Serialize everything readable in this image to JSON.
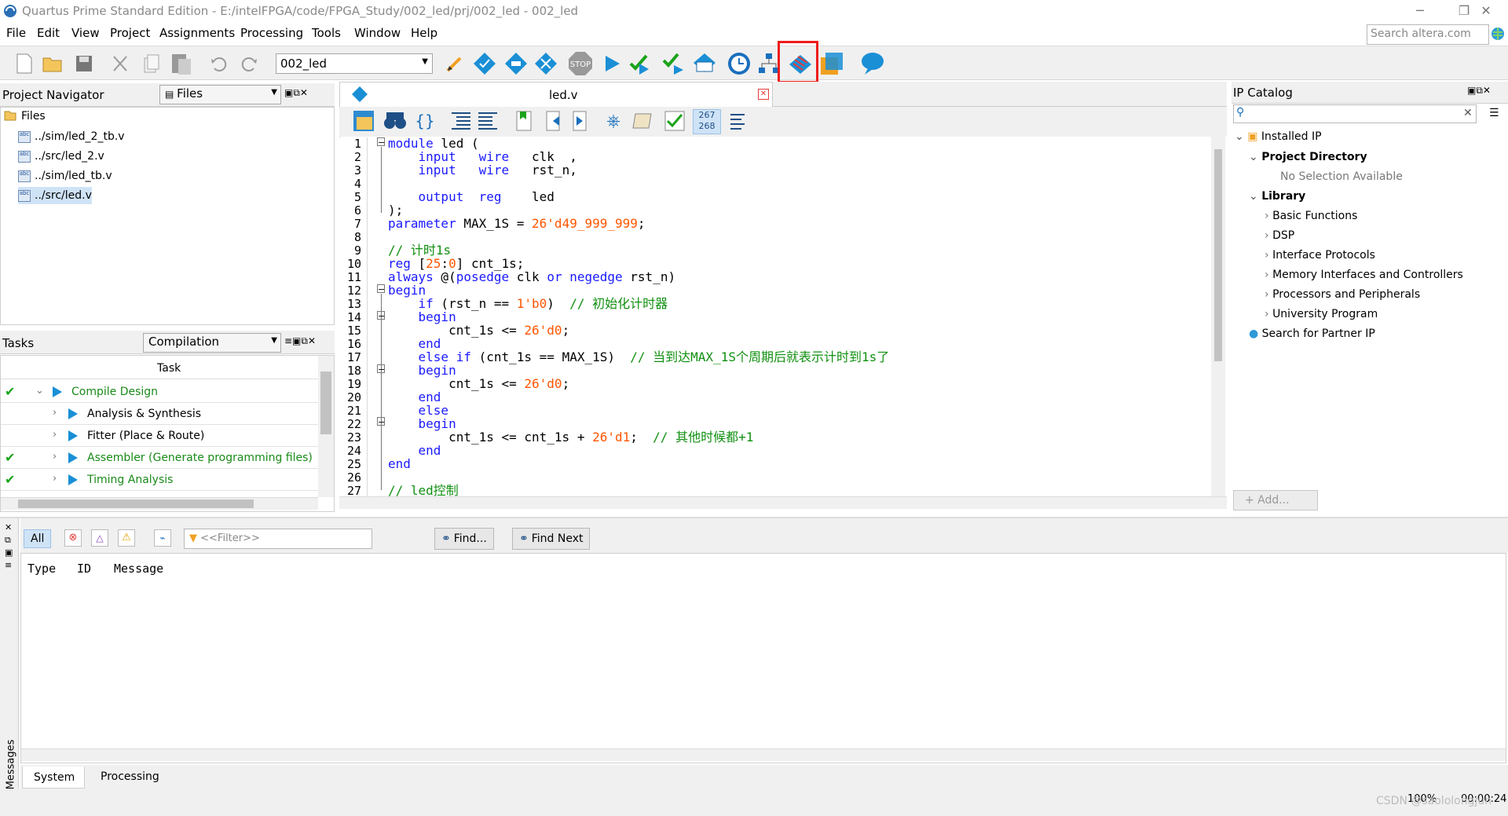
{
  "window": {
    "title": "Quartus Prime Standard Edition - E:/intelFPGA/code/FPGA_Study/002_led/prj/002_led - 002_led",
    "controls": [
      "─",
      "❐",
      "✕"
    ]
  },
  "menu": [
    "File",
    "Edit",
    "View",
    "Project",
    "Assignments",
    "Processing",
    "Tools",
    "Window",
    "Help"
  ],
  "search": {
    "placeholder": "Search altera.com"
  },
  "toolbar": {
    "project_value": "002_led",
    "stop_label": "STOP",
    "icons": [
      "new-file",
      "open-file",
      "save",
      "cut",
      "copy",
      "paste",
      "undo",
      "redo",
      "pin-planner",
      "compile-design",
      "analysis-synthesis",
      "fitter",
      "stop",
      "start-compilation",
      "analysis-elaboration",
      "assembler",
      "timing-analyzer",
      "chip-planner",
      "netlist-viewer",
      "programmer",
      "ip-catalog-tool",
      "help-balloon"
    ]
  },
  "project_navigator": {
    "title": "Project Navigator",
    "view": "Files",
    "root": "Files",
    "files": [
      "../sim/led_2_tb.v",
      "../src/led_2.v",
      "../sim/led_tb.v",
      "../src/led.v"
    ]
  },
  "tasks": {
    "title": "Tasks",
    "flow": "Compilation",
    "header": "Task",
    "rows": [
      {
        "label": "Compile Design",
        "done": true
      },
      {
        "label": "Analysis & Synthesis",
        "done": false
      },
      {
        "label": "Fitter (Place & Route)",
        "done": false
      },
      {
        "label": "Assembler (Generate programming files)",
        "done": true
      },
      {
        "label": "Timing Analysis",
        "done": true
      }
    ]
  },
  "editor": {
    "tab": "led.v",
    "line_counter": [
      "267",
      "268"
    ],
    "line_numbers": [
      "1",
      "2",
      "3",
      "4",
      "5",
      "6",
      "7",
      "8",
      "9",
      "10",
      "11",
      "12",
      "13",
      "14",
      "15",
      "16",
      "17",
      "18",
      "19",
      "20",
      "21",
      "22",
      "23",
      "24",
      "25",
      "26",
      "27"
    ]
  },
  "ip_catalog": {
    "title": "IP Catalog",
    "installed": "Installed IP",
    "project_directory": "Project Directory",
    "no_selection": "No Selection Available",
    "library": "Library",
    "categories": [
      "Basic Functions",
      "DSP",
      "Interface Protocols",
      "Memory Interfaces and Controllers",
      "Processors and Peripherals",
      "University Program"
    ],
    "partner": "Search for Partner IP",
    "add_button": "+ Add..."
  },
  "messages": {
    "filter_all": "All",
    "filter_placeholder": "<<Filter>>",
    "find": "Find...",
    "find_next": "Find Next",
    "columns": [
      "Type",
      "ID",
      "Message"
    ],
    "side_label": "Messages",
    "tabs": [
      "System",
      "Processing"
    ]
  },
  "status": {
    "zoom": "100%",
    "time": "00:00:24",
    "watermark": "CSDN @saololongjun"
  },
  "colors": {
    "accent_blue": "#1a8fd6",
    "highlight_red": "#ee1c1c",
    "keyword": "#1a1aff",
    "number": "#ff5500",
    "comment": "#109010"
  }
}
